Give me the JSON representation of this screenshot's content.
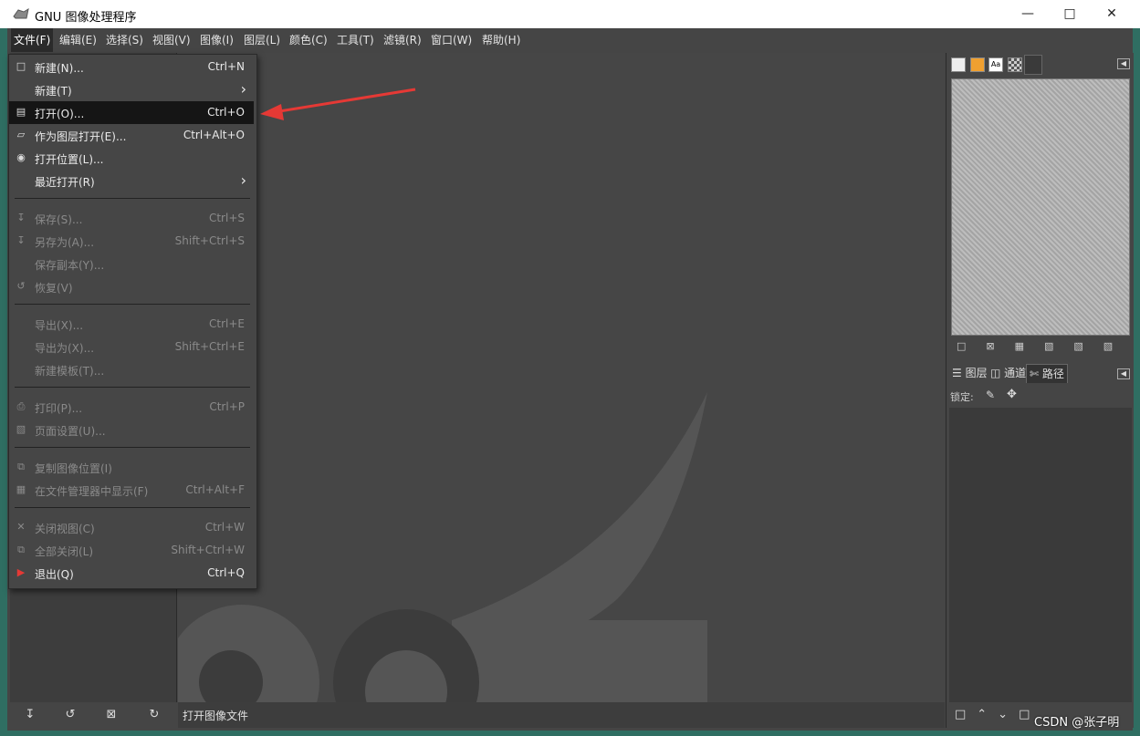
{
  "window": {
    "title": "GNU 图像处理程序"
  },
  "menubar": [
    "文件(F)",
    "编辑(E)",
    "选择(S)",
    "视图(V)",
    "图像(I)",
    "图层(L)",
    "颜色(C)",
    "工具(T)",
    "滤镜(R)",
    "窗口(W)",
    "帮助(H)"
  ],
  "file_menu": {
    "new": {
      "label": "新建(N)...",
      "acc": "Ctrl+N"
    },
    "create": {
      "label": "新建(T)"
    },
    "open": {
      "label": "打开(O)...",
      "acc": "Ctrl+O"
    },
    "open_as_layers": {
      "label": "作为图层打开(E)...",
      "acc": "Ctrl+Alt+O"
    },
    "open_location": {
      "label": "打开位置(L)..."
    },
    "open_recent": {
      "label": "最近打开(R)"
    },
    "save": {
      "label": "保存(S)...",
      "acc": "Ctrl+S"
    },
    "save_as": {
      "label": "另存为(A)...",
      "acc": "Shift+Ctrl+S"
    },
    "save_copy": {
      "label": "保存副本(Y)..."
    },
    "revert": {
      "label": "恢复(V)"
    },
    "export": {
      "label": "导出(X)...",
      "acc": "Ctrl+E"
    },
    "export_as": {
      "label": "导出为(X)...",
      "acc": "Shift+Ctrl+E"
    },
    "create_template": {
      "label": "新建模板(T)..."
    },
    "print": {
      "label": "打印(P)...",
      "acc": "Ctrl+P"
    },
    "page_setup": {
      "label": "页面设置(U)..."
    },
    "copy_location": {
      "label": "复制图像位置(I)"
    },
    "show_in_fm": {
      "label": "在文件管理器中显示(F)",
      "acc": "Ctrl+Alt+F"
    },
    "close_view": {
      "label": "关闭视图(C)",
      "acc": "Ctrl+W"
    },
    "close_all": {
      "label": "全部关闭(L)",
      "acc": "Shift+Ctrl+W"
    },
    "quit": {
      "label": "退出(Q)",
      "acc": "Ctrl+Q"
    }
  },
  "status": {
    "text": "打开图像文件"
  },
  "dock": {
    "tabs": [
      "图层",
      "通道",
      "路径"
    ],
    "lock_label": "锁定:"
  },
  "watermark": "CSDN @张子明",
  "colors": {
    "accent_arrow": "#e53935",
    "menu_bg": "#464646",
    "selected_bg": "#151515"
  }
}
